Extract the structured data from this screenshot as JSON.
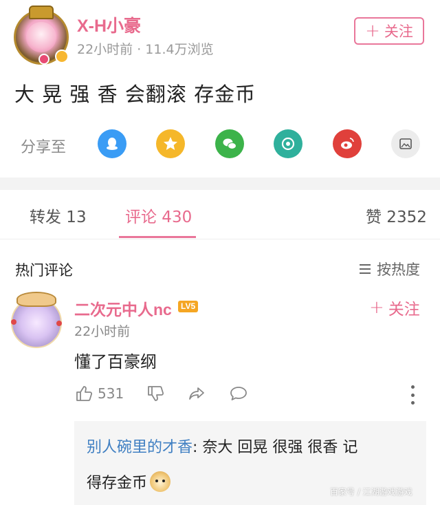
{
  "post": {
    "username": "X-H小豪",
    "meta": "22小时前 · 11.4万浏览",
    "follow_label": "关注",
    "text": "大 晃 强 香 会翻滚 存金币"
  },
  "share": {
    "label": "分享至",
    "icons": [
      {
        "name": "qq-icon",
        "color": "#3a9cf5"
      },
      {
        "name": "qzone-icon",
        "color": "#f5b72a"
      },
      {
        "name": "wechat-icon",
        "color": "#3cb34a"
      },
      {
        "name": "moments-icon",
        "color": "#2fb09c"
      },
      {
        "name": "weibo-icon",
        "color": "#e0403b"
      },
      {
        "name": "save-image-icon",
        "color": "#ececec"
      }
    ]
  },
  "tabs": {
    "repost": "转发 13",
    "comments": "评论 430",
    "likes": "赞 2352"
  },
  "comments_section": {
    "title": "热门评论",
    "sort_label": "按热度"
  },
  "comment": {
    "username": "二次元中人nc",
    "level": "LV5",
    "follow_label": "关注",
    "time": "22小时前",
    "text": "懂了百豪纲",
    "like_count": "531"
  },
  "reply": {
    "username": "别人碗里的才香",
    "line1_text": ": 奈大 回晃 很强 很香 记",
    "line2_text": "得存金币"
  },
  "watermark": "百家号 / 江湖游戏游戏"
}
